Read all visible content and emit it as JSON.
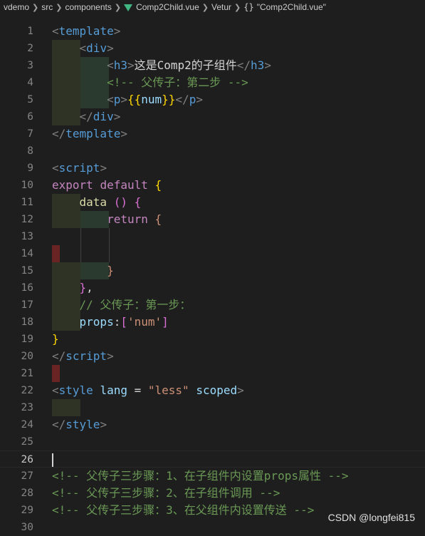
{
  "breadcrumb": {
    "items": [
      "vdemo",
      "src",
      "components",
      "Comp2Child.vue",
      "Vetur",
      "\"Comp2Child.vue\""
    ],
    "file_icon": "vue-file-icon",
    "symbol_icon": "braces-icon"
  },
  "editor": {
    "active_line": 26,
    "lines": [
      {
        "n": "1",
        "tokens": [
          [
            "bracket",
            "<"
          ],
          [
            "tag",
            "template"
          ],
          [
            "bracket",
            ">"
          ]
        ]
      },
      {
        "n": "2",
        "tokens": [
          [
            "text",
            "    "
          ],
          [
            "bracket",
            "<"
          ],
          [
            "tag",
            "div"
          ],
          [
            "bracket",
            ">"
          ]
        ]
      },
      {
        "n": "3",
        "tokens": [
          [
            "text",
            "        "
          ],
          [
            "bracket",
            "<"
          ],
          [
            "tag",
            "h3"
          ],
          [
            "bracket",
            ">"
          ],
          [
            "text",
            "这是Comp2的子组件"
          ],
          [
            "bracket",
            "</"
          ],
          [
            "tag",
            "h3"
          ],
          [
            "bracket",
            ">"
          ]
        ]
      },
      {
        "n": "4",
        "tokens": [
          [
            "text",
            "        "
          ],
          [
            "comment",
            "<!-- 父传子：第二步 -->"
          ]
        ]
      },
      {
        "n": "5",
        "tokens": [
          [
            "text",
            "        "
          ],
          [
            "bracket",
            "<"
          ],
          [
            "tag",
            "p"
          ],
          [
            "bracket",
            ">"
          ],
          [
            "b1",
            "{{"
          ],
          [
            "prop",
            "num"
          ],
          [
            "b1",
            "}}"
          ],
          [
            "bracket",
            "</"
          ],
          [
            "tag",
            "p"
          ],
          [
            "bracket",
            ">"
          ]
        ]
      },
      {
        "n": "6",
        "tokens": [
          [
            "text",
            "    "
          ],
          [
            "bracket",
            "</"
          ],
          [
            "tag",
            "div"
          ],
          [
            "bracket",
            ">"
          ]
        ]
      },
      {
        "n": "7",
        "tokens": [
          [
            "bracket",
            "</"
          ],
          [
            "tag",
            "template"
          ],
          [
            "bracket",
            ">"
          ]
        ]
      },
      {
        "n": "8",
        "tokens": []
      },
      {
        "n": "9",
        "tokens": [
          [
            "bracket",
            "<"
          ],
          [
            "tag",
            "script"
          ],
          [
            "bracket",
            ">"
          ]
        ]
      },
      {
        "n": "10",
        "tokens": [
          [
            "keyword",
            "export"
          ],
          [
            "text",
            " "
          ],
          [
            "keyword",
            "default"
          ],
          [
            "text",
            " "
          ],
          [
            "b1",
            "{"
          ]
        ]
      },
      {
        "n": "11",
        "tokens": [
          [
            "text",
            "    "
          ],
          [
            "fn",
            "data"
          ],
          [
            "text",
            " "
          ],
          [
            "b2",
            "()"
          ],
          [
            "text",
            " "
          ],
          [
            "b2",
            "{"
          ]
        ]
      },
      {
        "n": "12",
        "tokens": [
          [
            "text",
            "        "
          ],
          [
            "keyword",
            "return"
          ],
          [
            "text",
            " "
          ],
          [
            "str",
            "{"
          ]
        ]
      },
      {
        "n": "13",
        "tokens": []
      },
      {
        "n": "14",
        "tokens": []
      },
      {
        "n": "15",
        "tokens": [
          [
            "text",
            "        "
          ],
          [
            "str",
            "}"
          ]
        ]
      },
      {
        "n": "16",
        "tokens": [
          [
            "text",
            "    "
          ],
          [
            "b2",
            "}"
          ],
          [
            "text",
            ","
          ]
        ]
      },
      {
        "n": "17",
        "tokens": [
          [
            "text",
            "    "
          ],
          [
            "comment",
            "// 父传子：第一步："
          ]
        ]
      },
      {
        "n": "18",
        "tokens": [
          [
            "text",
            "    "
          ],
          [
            "prop",
            "props"
          ],
          [
            "text",
            ":"
          ],
          [
            "b2",
            "["
          ],
          [
            "str",
            "'num'"
          ],
          [
            "b2",
            "]"
          ]
        ]
      },
      {
        "n": "19",
        "tokens": [
          [
            "b1",
            "}"
          ]
        ]
      },
      {
        "n": "20",
        "tokens": [
          [
            "bracket",
            "</"
          ],
          [
            "tag",
            "script"
          ],
          [
            "bracket",
            ">"
          ]
        ]
      },
      {
        "n": "21",
        "tokens": []
      },
      {
        "n": "22",
        "tokens": [
          [
            "bracket",
            "<"
          ],
          [
            "tag",
            "style"
          ],
          [
            "text",
            " "
          ],
          [
            "prop",
            "lang"
          ],
          [
            "text",
            " = "
          ],
          [
            "str",
            "\"less\""
          ],
          [
            "text",
            " "
          ],
          [
            "prop",
            "scoped"
          ],
          [
            "bracket",
            ">"
          ]
        ]
      },
      {
        "n": "23",
        "tokens": []
      },
      {
        "n": "24",
        "tokens": [
          [
            "bracket",
            "</"
          ],
          [
            "tag",
            "style"
          ],
          [
            "bracket",
            ">"
          ]
        ]
      },
      {
        "n": "25",
        "tokens": []
      },
      {
        "n": "26",
        "tokens": []
      },
      {
        "n": "27",
        "tokens": [
          [
            "comment",
            "<!-- 父传子三步骤：1、在子组件内设置props属性 -->"
          ]
        ]
      },
      {
        "n": "28",
        "tokens": [
          [
            "comment",
            "<!-- 父传子三步骤：2、在子组件调用 -->"
          ]
        ]
      },
      {
        "n": "29",
        "tokens": [
          [
            "comment",
            "<!-- 父传子三步骤：3、在父组件内设置传送 -->"
          ]
        ]
      },
      {
        "n": "30",
        "tokens": []
      }
    ]
  },
  "watermark": "CSDN @longfei815"
}
